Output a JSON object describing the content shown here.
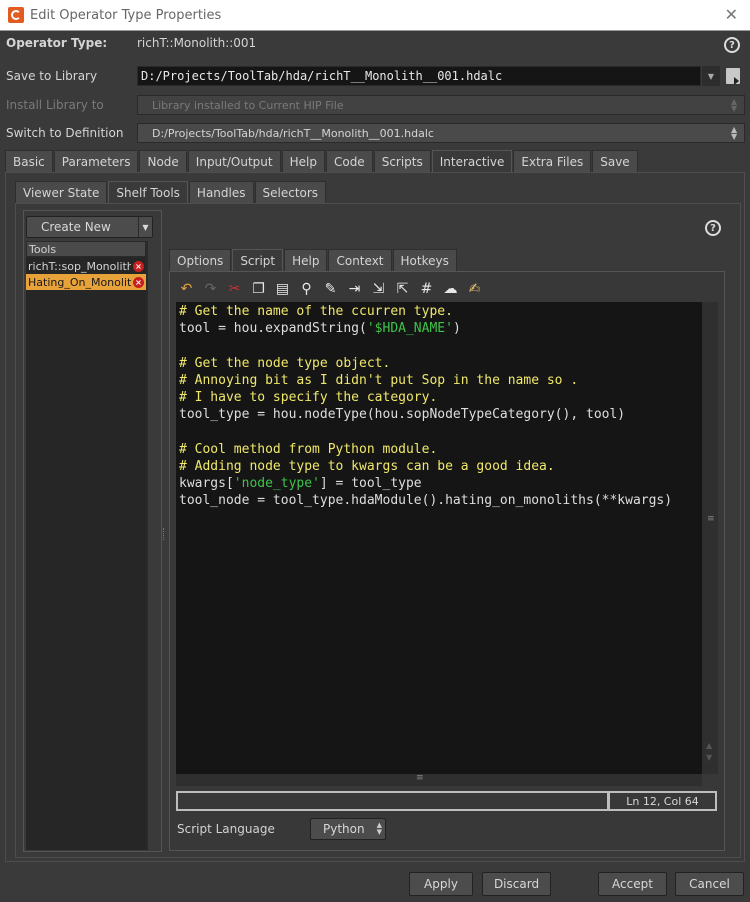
{
  "window": {
    "title": "Edit Operator Type Properties",
    "close_glyph": "✕"
  },
  "header": {
    "operator_type_label": "Operator Type:",
    "operator_type_value": "richT::Monolith::001",
    "save_to_library_label": "Save to Library",
    "save_to_library_value": "D:/Projects/ToolTab/hda/richT__Monolith__001.hdalc",
    "install_library_label": "Install Library to",
    "install_library_value": "Library installed to Current HIP File",
    "switch_definition_label": "Switch to Definition",
    "switch_definition_value": "D:/Projects/ToolTab/hda/richT__Monolith__001.hdalc",
    "help_glyph": "?"
  },
  "main_tabs": [
    "Basic",
    "Parameters",
    "Node",
    "Input/Output",
    "Help",
    "Code",
    "Scripts",
    "Interactive",
    "Extra Files",
    "Save"
  ],
  "main_tab_active": "Interactive",
  "sub_tabs": [
    "Viewer State",
    "Shelf Tools",
    "Handles",
    "Selectors"
  ],
  "sub_tab_active": "Shelf Tools",
  "tools_panel": {
    "create_new_label": "Create New",
    "list_header": "Tools",
    "items": [
      {
        "label": "richT::sop_Monolith",
        "selected": false
      },
      {
        "label": "Hating_On_Monolit",
        "selected": true
      }
    ]
  },
  "tool_tabs": [
    "Options",
    "Script",
    "Help",
    "Context",
    "Hotkeys"
  ],
  "tool_tab_active": "Script",
  "toolbar_icons": [
    "undo-icon",
    "redo-icon",
    "cut-icon",
    "copy-icon",
    "paste-icon",
    "find-icon",
    "replace-icon",
    "goto-line-icon",
    "indent-icon",
    "unindent-icon",
    "comment-icon",
    "uncomment-icon",
    "edit-icon"
  ],
  "code_lines": [
    [
      {
        "t": "# Get the name of the ccurren type.",
        "c": "com"
      }
    ],
    [
      {
        "t": "tool = hou.expandString(",
        "c": ""
      },
      {
        "t": "'$HDA_NAME'",
        "c": "str"
      },
      {
        "t": ")",
        "c": ""
      }
    ],
    [
      {
        "t": "",
        "c": ""
      }
    ],
    [
      {
        "t": "# Get the node type object.",
        "c": "com"
      }
    ],
    [
      {
        "t": "# Annoying bit as I didn't put Sop in the name so .",
        "c": "com"
      }
    ],
    [
      {
        "t": "# I have to specify the category.",
        "c": "com"
      }
    ],
    [
      {
        "t": "tool_type = hou.nodeType(hou.sopNodeTypeCategory(), tool)",
        "c": ""
      }
    ],
    [
      {
        "t": "",
        "c": ""
      }
    ],
    [
      {
        "t": "# Cool method from Python module.",
        "c": "com"
      }
    ],
    [
      {
        "t": "# Adding node type to kwargs can be a good idea.",
        "c": "com"
      }
    ],
    [
      {
        "t": "kwargs[",
        "c": ""
      },
      {
        "t": "'node_type'",
        "c": "str"
      },
      {
        "t": "] = tool_type",
        "c": ""
      }
    ],
    [
      {
        "t": "tool_node = tool_type.hdaModule().hating_on_monoliths(**kwargs)",
        "c": ""
      }
    ]
  ],
  "status": {
    "position": "Ln 12, Col 64"
  },
  "script_language": {
    "label": "Script Language",
    "value": "Python"
  },
  "buttons": {
    "apply": "Apply",
    "discard": "Discard",
    "accept": "Accept",
    "cancel": "Cancel"
  },
  "colors": {
    "comment": "#f0e86a",
    "string": "#3fc34a",
    "selection": "#e8a23a",
    "accent": "#e25b1f"
  }
}
